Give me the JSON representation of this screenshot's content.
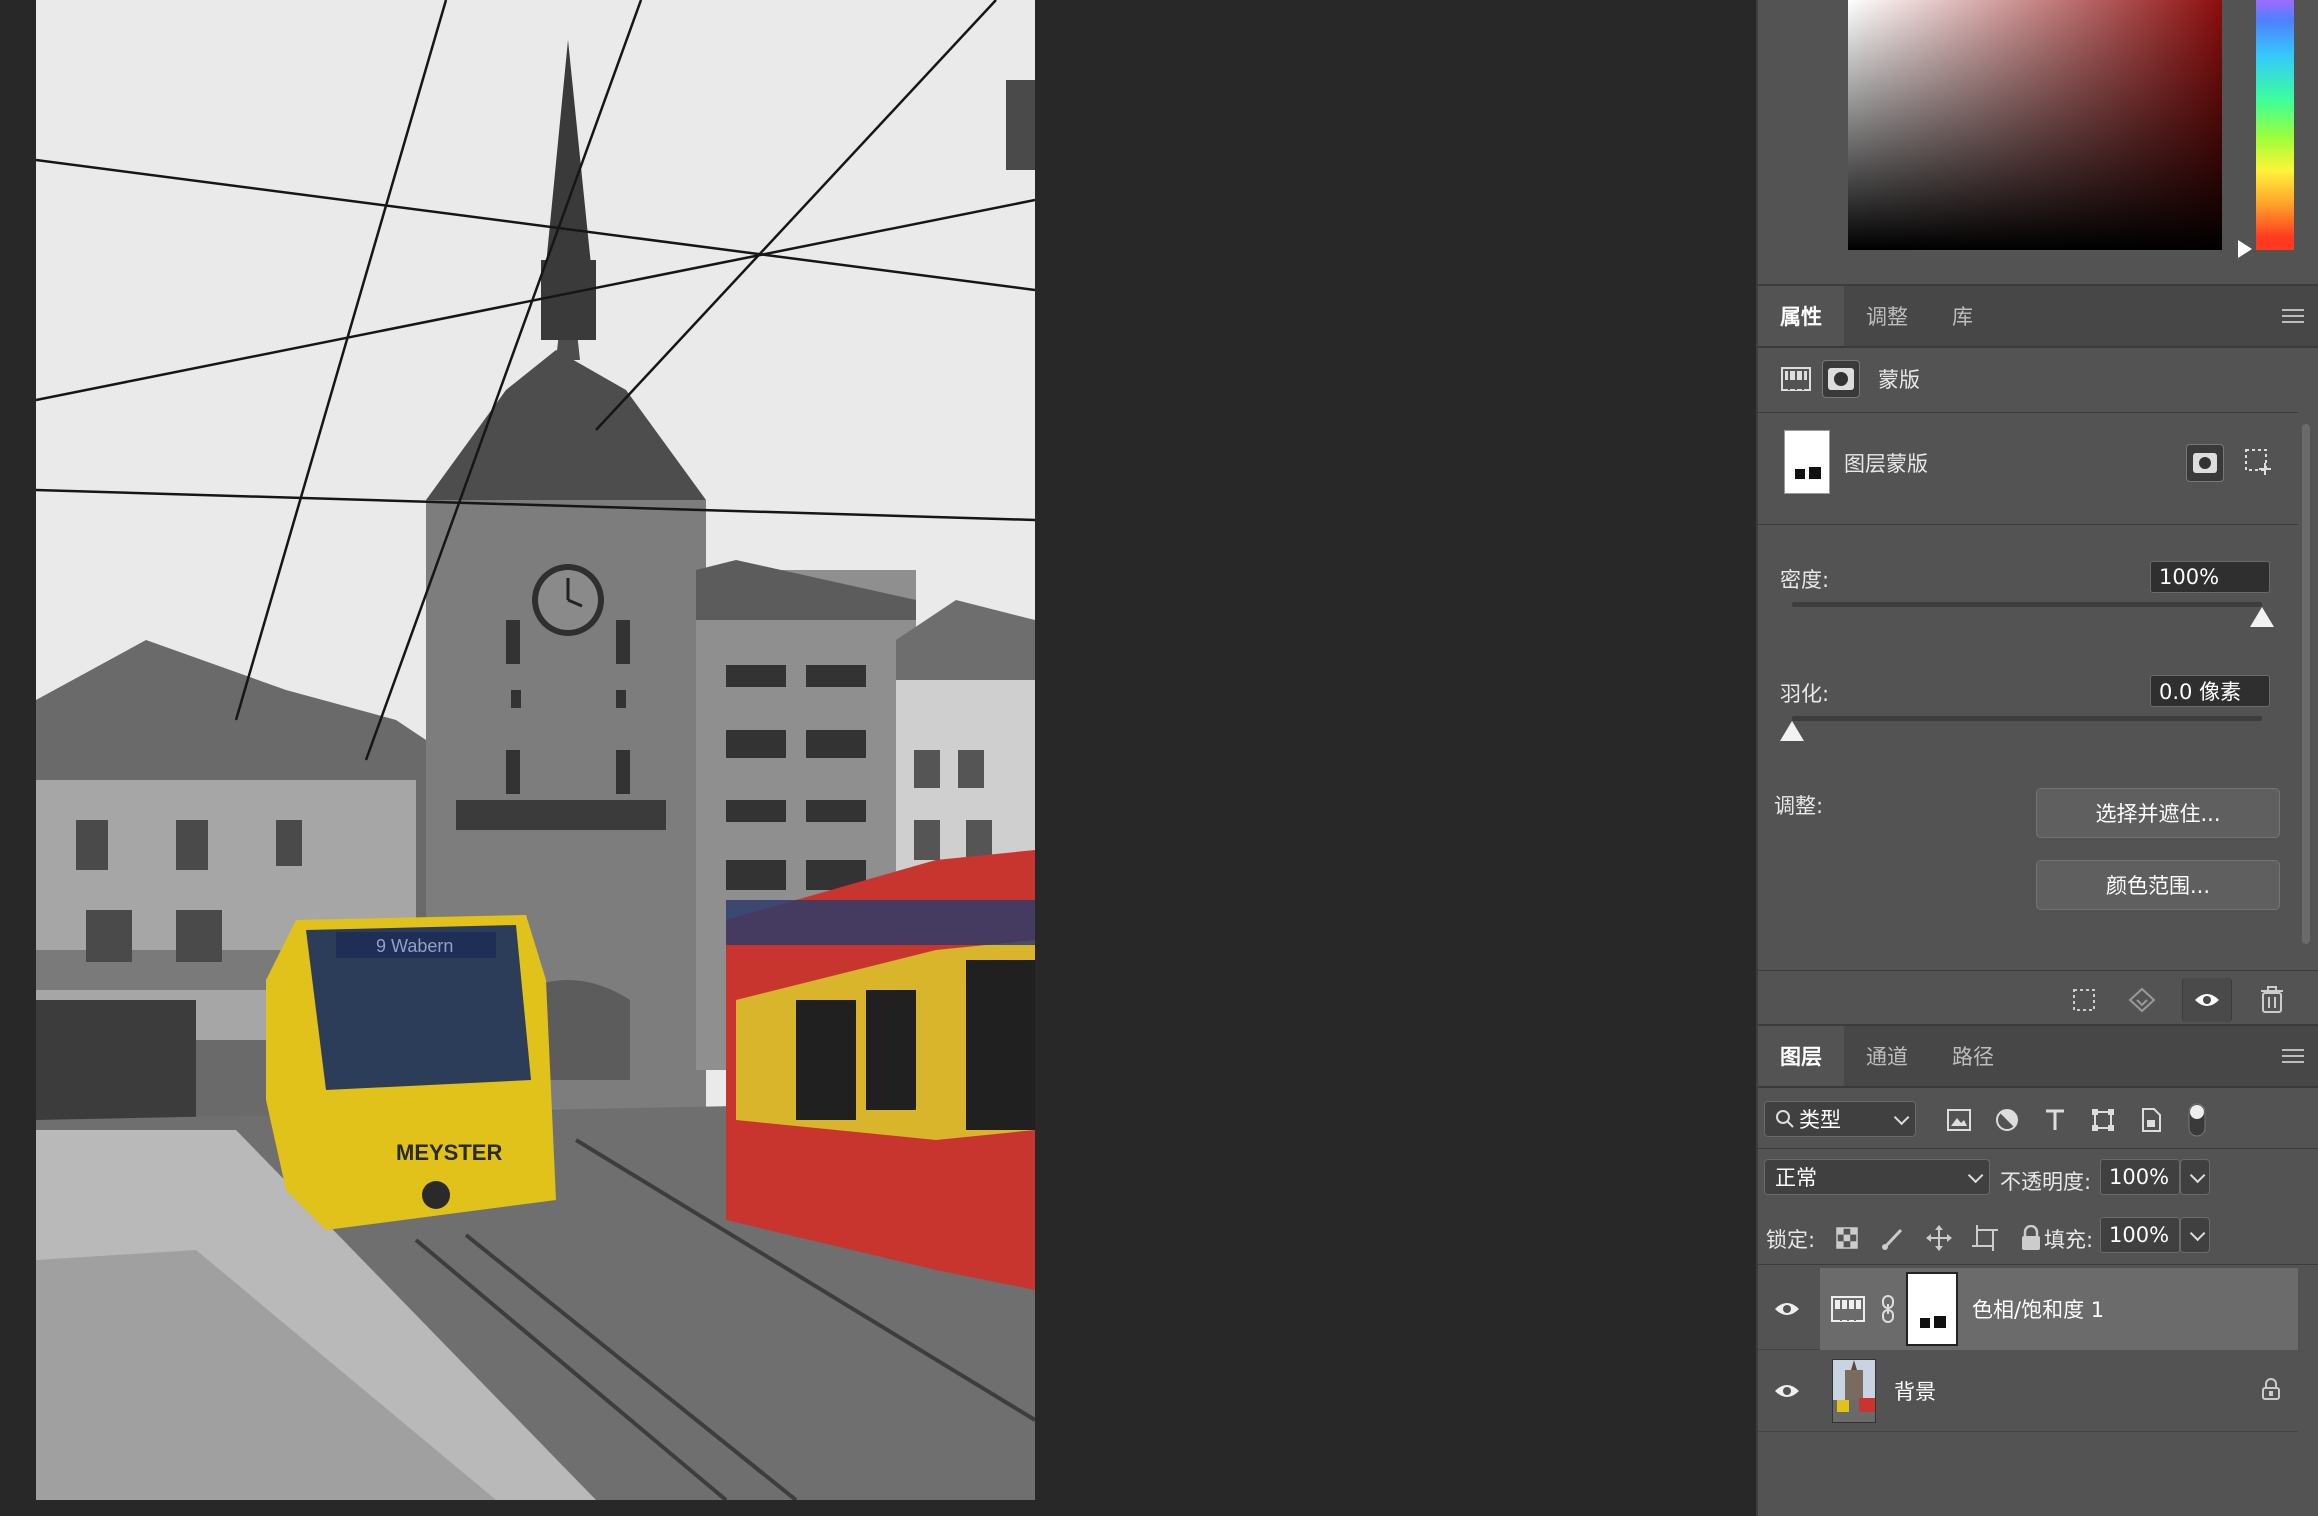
{
  "properties_tabs": [
    "属性",
    "调整",
    "库"
  ],
  "mask_section": {
    "header_label": "蒙版",
    "layer_mask_label": "图层蒙版"
  },
  "density": {
    "label": "密度:",
    "value": "100%",
    "fraction": 1.0
  },
  "feather": {
    "label": "羽化:",
    "value": "0.0 像素",
    "fraction": 0.0
  },
  "refine": {
    "label": "调整:",
    "select_and_mask": "选择并遮住...",
    "color_range": "颜色范围..."
  },
  "layers_tabs": [
    "图层",
    "通道",
    "路径"
  ],
  "layers_toolbar": {
    "filter_kind": "类型",
    "blend_mode": "正常",
    "opacity_label": "不透明度:",
    "opacity_value": "100%",
    "lock_label": "锁定:",
    "fill_label": "填充:",
    "fill_value": "100%"
  },
  "layers": [
    {
      "name": "色相/饱和度 1",
      "selected": true,
      "visible": true
    },
    {
      "name": "背景",
      "selected": false,
      "visible": true,
      "locked": true
    }
  ],
  "photo": {
    "tram_left_destination": "9 Wabern",
    "tram_left_brand": "MEYSTER"
  },
  "colors": {
    "panel_bg": "#535353",
    "canvas_bg": "#282828",
    "selected_layer": "#6b6b6b",
    "picker_hue": "#8d0d0d"
  }
}
